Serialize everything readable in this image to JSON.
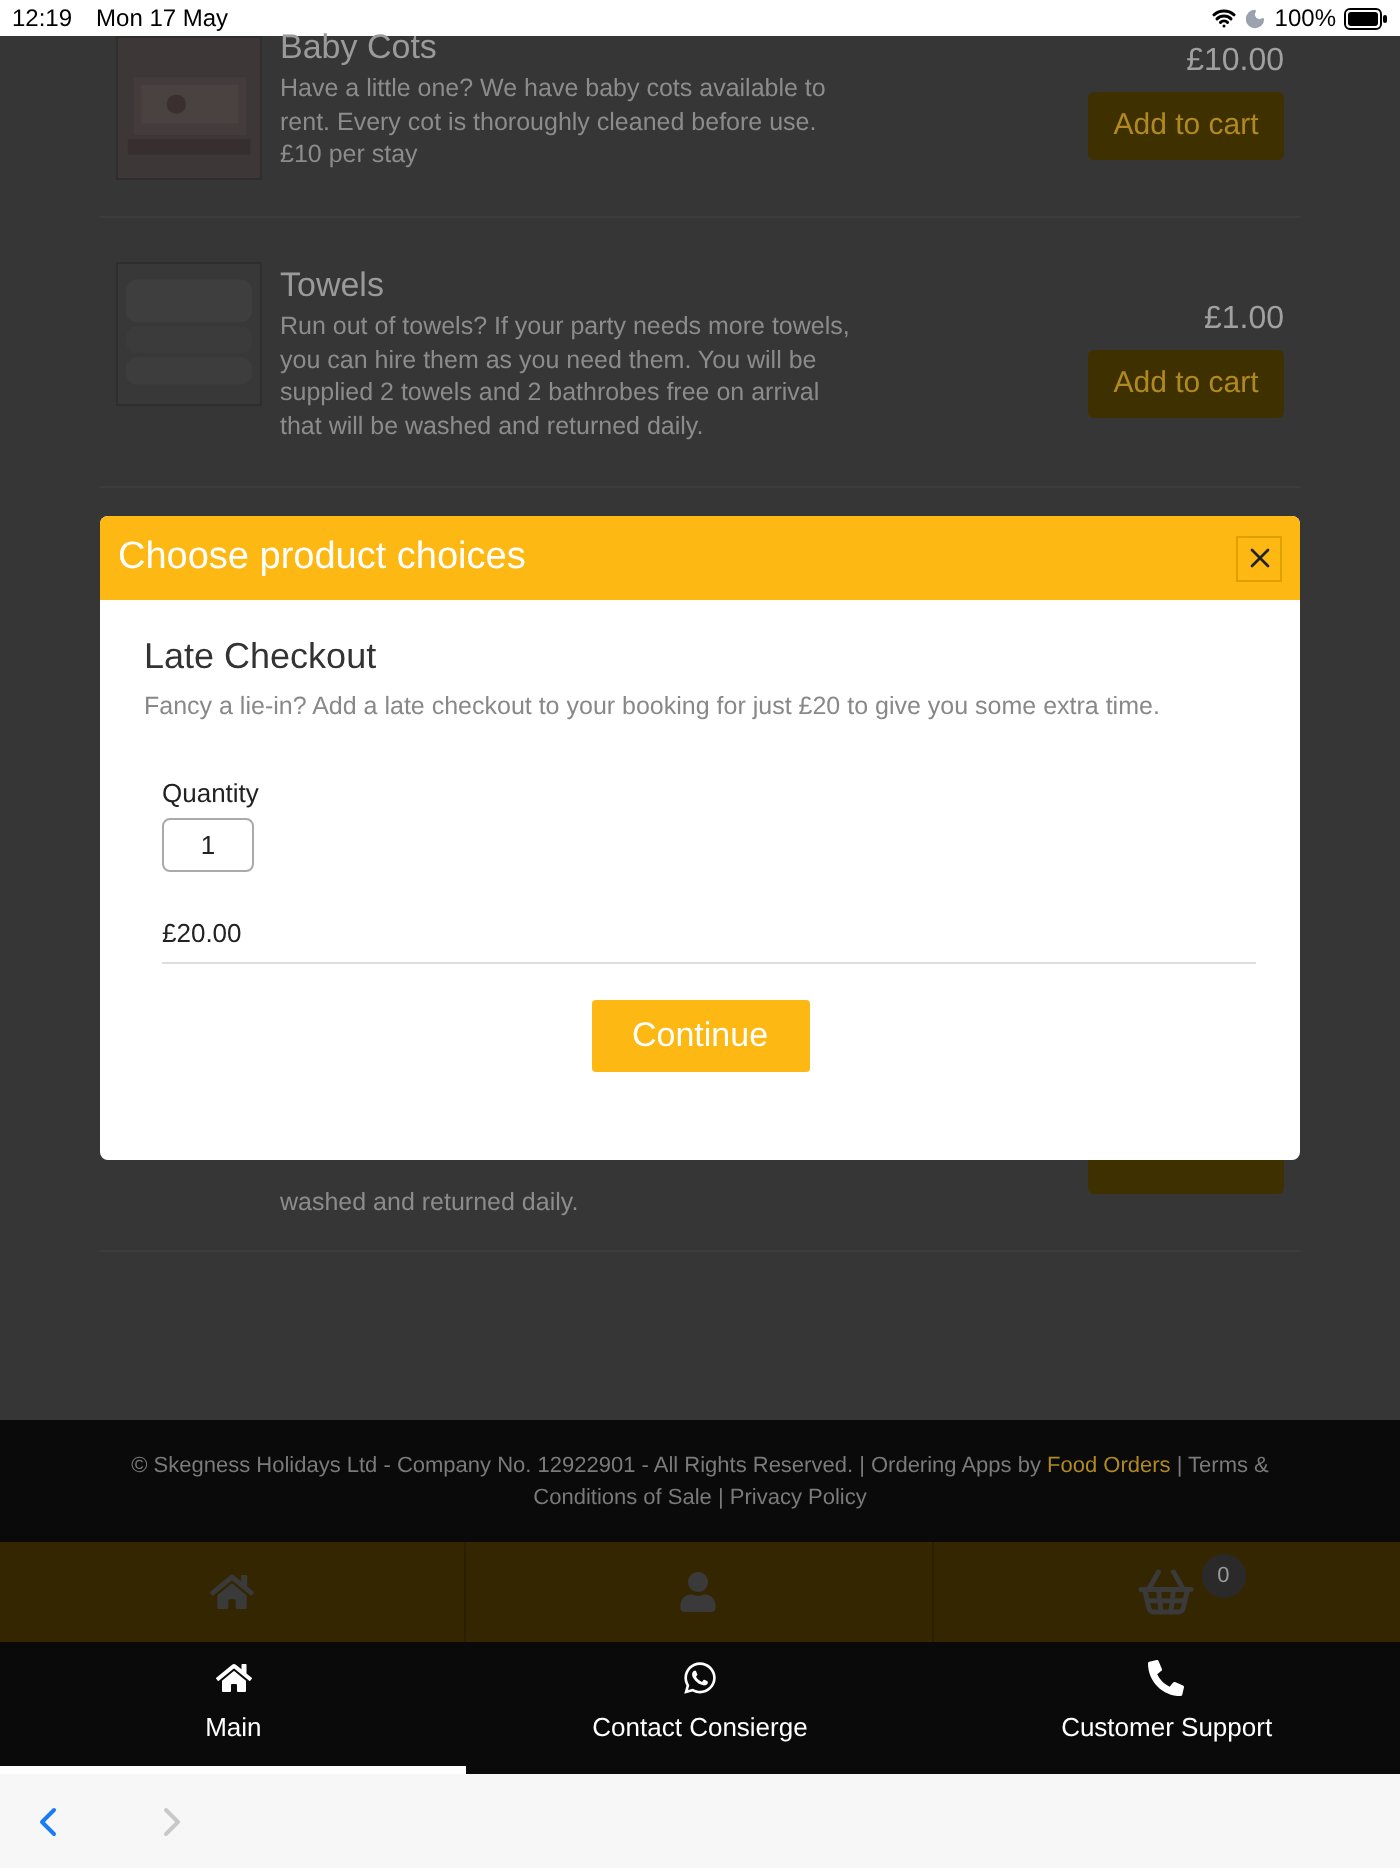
{
  "status_bar": {
    "time": "12:19",
    "date": "Mon 17 May",
    "battery": "100%"
  },
  "products": [
    {
      "kind": "full",
      "title": "Baby Cots",
      "description": "Have a little one? We have baby cots available to rent. Every cot is thoroughly cleaned before use. £10 per stay",
      "price": "£10.00",
      "button": "Add to cart"
    },
    {
      "kind": "full",
      "title": "Towels",
      "description": "Run out of towels? If your party needs more towels, you can hire them as you need them. You will be supplied 2 towels and 2 bathrobes free on arrival that will be washed and returned daily.",
      "price": "£1.00",
      "button": "Add to cart"
    },
    {
      "kind": "partial",
      "description": "washed and returned daily."
    }
  ],
  "footer": {
    "before": "© Skegness Holidays Ltd - Company No. 12922901 - All Rights Reserved. | Ordering Apps by ",
    "link": "Food Orders",
    "after": " | Terms & Conditions of Sale | Privacy Policy"
  },
  "shop_bar": {
    "cart_count": "0"
  },
  "tabs": [
    {
      "label": "Main",
      "selected": true
    },
    {
      "label": "Contact Consierge",
      "selected": false
    },
    {
      "label": "Customer Support",
      "selected": false
    }
  ],
  "browser_nav": {
    "back_disabled": false,
    "forward_disabled": true
  },
  "modal": {
    "title": "Choose product choices",
    "product": "Late Checkout",
    "description": "Fancy a lie-in? Add a late checkout to your booking for just £20 to give you some extra time.",
    "quantity_label": "Quantity",
    "quantity": "1",
    "price": "£20.00",
    "button": "Continue"
  }
}
